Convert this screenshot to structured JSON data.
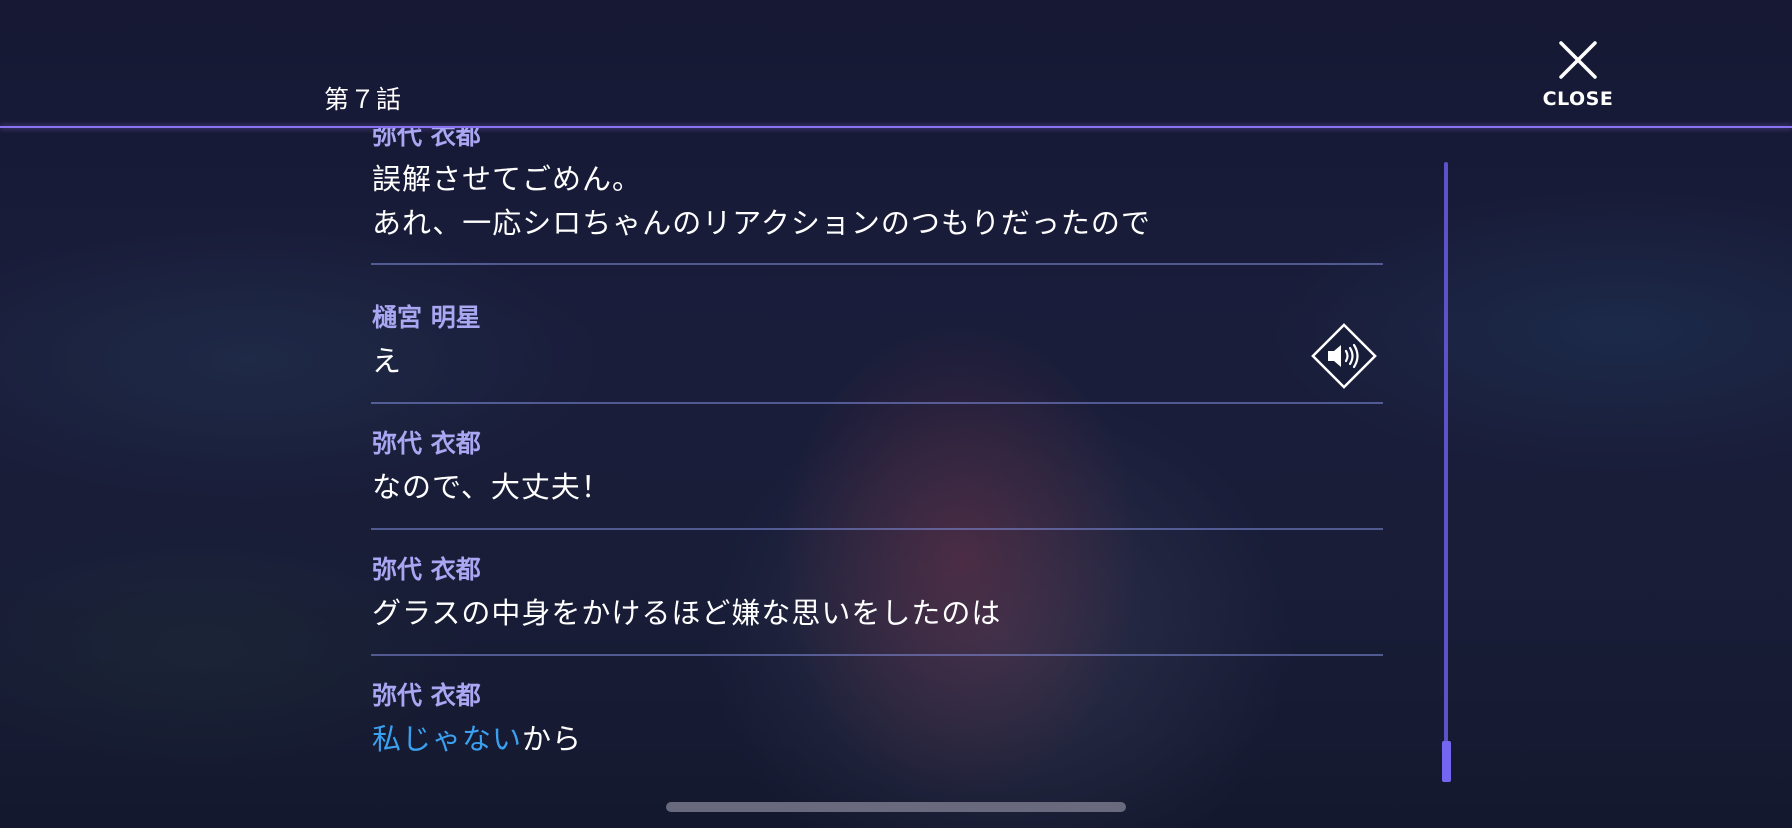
{
  "header": {
    "episode_title": "第７話",
    "close_label": "CLOSE"
  },
  "log": [
    {
      "speaker": "弥代 衣都",
      "lines": [
        "誤解させてごめん。",
        "あれ、一応シロちゃんのリアクションのつもりだったので"
      ]
    },
    {
      "speaker": "樋宮 明星",
      "lines": [
        "え"
      ],
      "has_voice": true
    },
    {
      "speaker": "弥代 衣都",
      "lines": [
        "なので、大丈夫！"
      ]
    },
    {
      "speaker": "弥代 衣都",
      "lines": [
        "グラスの中身をかけるほど嫌な思いをしたのは"
      ]
    },
    {
      "speaker": "弥代 衣都",
      "highlight": "私じゃない",
      "rest": "から"
    }
  ],
  "icons": {
    "close": "close-icon",
    "voice": "speaker-icon"
  },
  "colors": {
    "accent": "#8a72f0",
    "speaker_name": "#a9a6f2",
    "highlight": "#3aa0f0"
  }
}
